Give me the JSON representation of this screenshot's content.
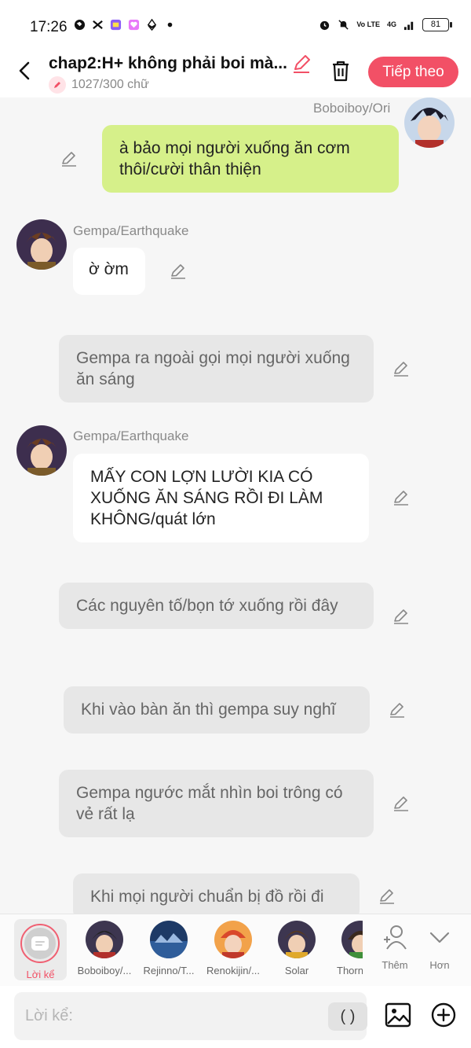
{
  "status_bar": {
    "time": "17:26",
    "battery": "81",
    "network": "4G",
    "volte": "Vo LTE"
  },
  "header": {
    "chapter_title": "chap2:H+ không phải boi mà...",
    "word_count": "1027/300 chữ",
    "next_button": "Tiếp theo"
  },
  "messages": [
    {
      "speaker": "Boboiboy/Ori",
      "text": "à bảo mọi người xuống ăn cơm thôi/cười thân thiện",
      "style": "green"
    },
    {
      "speaker": "Gempa/Earthquake",
      "text": "ờ ờm",
      "style": "white"
    },
    {
      "speaker": "",
      "text": "Gempa ra ngoài gọi mọi người xuống ăn sáng",
      "style": "narration"
    },
    {
      "speaker": "Gempa/Earthquake",
      "text": "MẤY CON LỢN LƯỜI KIA CÓ XUỐNG ĂN SÁNG RỒI ĐI LÀM KHÔNG/quát lớn",
      "style": "white"
    },
    {
      "speaker": "",
      "text": "Các nguyên tố/bọn tớ xuống rồi đây",
      "style": "narration"
    },
    {
      "speaker": "",
      "text": "Khi vào bàn ăn thì gempa suy nghĩ",
      "style": "narration"
    },
    {
      "speaker": "",
      "text": "Gempa ngước mắt nhìn boi trông có vẻ rất lạ",
      "style": "narration"
    },
    {
      "speaker": "",
      "text": "Khi mọi người chuẩn bị đồ rồi đi",
      "style": "narration"
    }
  ],
  "character_bar": {
    "narration_label": "Lời kể",
    "characters": [
      {
        "name": "Boboiboy/...",
        "avatar": "boboiboy"
      },
      {
        "name": "Rejinno/T...",
        "avatar": "rejinno"
      },
      {
        "name": "Renokijin/...",
        "avatar": "renokijin"
      },
      {
        "name": "Solar",
        "avatar": "solar"
      },
      {
        "name": "Thorn",
        "avatar": "thorn"
      }
    ],
    "add_label": "Thêm",
    "more_label": "Hơn"
  },
  "input_bar": {
    "placeholder": "Lời kể:",
    "paren_button": "( )"
  },
  "colors": {
    "accent": "#f25066",
    "user_bubble": "#d6f08a",
    "narration_bubble": "#e7e7e7"
  }
}
